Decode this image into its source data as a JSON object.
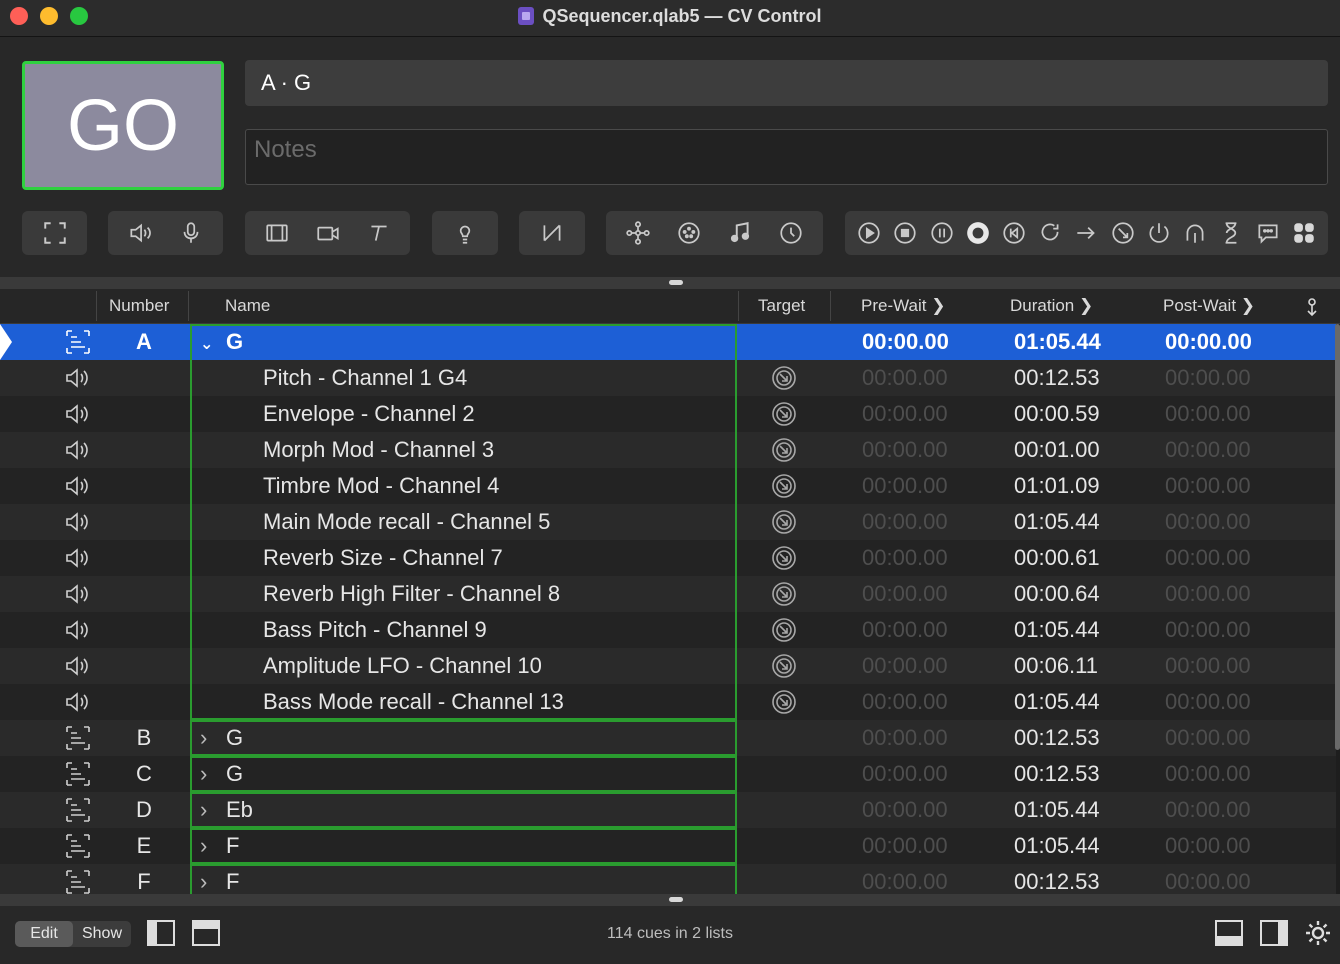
{
  "window": {
    "title": "QSequencer.qlab5 — CV Control"
  },
  "go": {
    "label": "GO"
  },
  "cue_title": "A · G",
  "notes": {
    "placeholder": "Notes"
  },
  "columns": [
    "Number",
    "Name",
    "Target",
    "Pre-Wait",
    "Duration",
    "Post-Wait"
  ],
  "rows": [
    {
      "type": "group",
      "number": "A",
      "name": "G",
      "expanded": true,
      "pre": "00:00.00",
      "dur": "01:05.44",
      "post": "00:00.00",
      "selected": true
    },
    {
      "type": "audio",
      "number": "",
      "name": "Pitch - Channel 1 G4",
      "child": true,
      "target": true,
      "pre": "00:00.00",
      "dur": "00:12.53",
      "post": "00:00.00"
    },
    {
      "type": "audio",
      "number": "",
      "name": "Envelope - Channel 2",
      "child": true,
      "target": true,
      "pre": "00:00.00",
      "dur": "00:00.59",
      "post": "00:00.00"
    },
    {
      "type": "audio",
      "number": "",
      "name": "Morph Mod - Channel 3",
      "child": true,
      "target": true,
      "pre": "00:00.00",
      "dur": "00:01.00",
      "post": "00:00.00"
    },
    {
      "type": "audio",
      "number": "",
      "name": "Timbre Mod - Channel 4",
      "child": true,
      "target": true,
      "pre": "00:00.00",
      "dur": "01:01.09",
      "post": "00:00.00"
    },
    {
      "type": "audio",
      "number": "",
      "name": "Main Mode recall - Channel 5",
      "child": true,
      "target": true,
      "pre": "00:00.00",
      "dur": "01:05.44",
      "post": "00:00.00"
    },
    {
      "type": "audio",
      "number": "",
      "name": "Reverb Size - Channel 7",
      "child": true,
      "target": true,
      "pre": "00:00.00",
      "dur": "00:00.61",
      "post": "00:00.00"
    },
    {
      "type": "audio",
      "number": "",
      "name": "Reverb High Filter - Channel 8",
      "child": true,
      "target": true,
      "pre": "00:00.00",
      "dur": "00:00.64",
      "post": "00:00.00"
    },
    {
      "type": "audio",
      "number": "",
      "name": "Bass Pitch - Channel 9",
      "child": true,
      "target": true,
      "pre": "00:00.00",
      "dur": "01:05.44",
      "post": "00:00.00"
    },
    {
      "type": "audio",
      "number": "",
      "name": "Amplitude LFO - Channel 10",
      "child": true,
      "target": true,
      "pre": "00:00.00",
      "dur": "00:06.11",
      "post": "00:00.00"
    },
    {
      "type": "audio",
      "number": "",
      "name": "Bass Mode recall - Channel 13",
      "child": true,
      "target": true,
      "pre": "00:00.00",
      "dur": "01:05.44",
      "post": "00:00.00"
    },
    {
      "type": "group",
      "number": "B",
      "name": "G",
      "expanded": false,
      "pre": "00:00.00",
      "dur": "00:12.53",
      "post": "00:00.00"
    },
    {
      "type": "group",
      "number": "C",
      "name": "G",
      "expanded": false,
      "pre": "00:00.00",
      "dur": "00:12.53",
      "post": "00:00.00"
    },
    {
      "type": "group",
      "number": "D",
      "name": "Eb",
      "expanded": false,
      "pre": "00:00.00",
      "dur": "01:05.44",
      "post": "00:00.00"
    },
    {
      "type": "group",
      "number": "E",
      "name": "F",
      "expanded": false,
      "pre": "00:00.00",
      "dur": "01:05.44",
      "post": "00:00.00"
    },
    {
      "type": "group",
      "number": "F",
      "name": "F",
      "expanded": false,
      "pre": "00:00.00",
      "dur": "00:12.53",
      "post": "00:00.00"
    }
  ],
  "footer": {
    "edit": "Edit",
    "show": "Show",
    "status": "114 cues in 2 lists"
  },
  "colors": {
    "go_border": "#2fd13f",
    "selection": "#1d5fd6",
    "group_outline": "#2a9c2f"
  }
}
